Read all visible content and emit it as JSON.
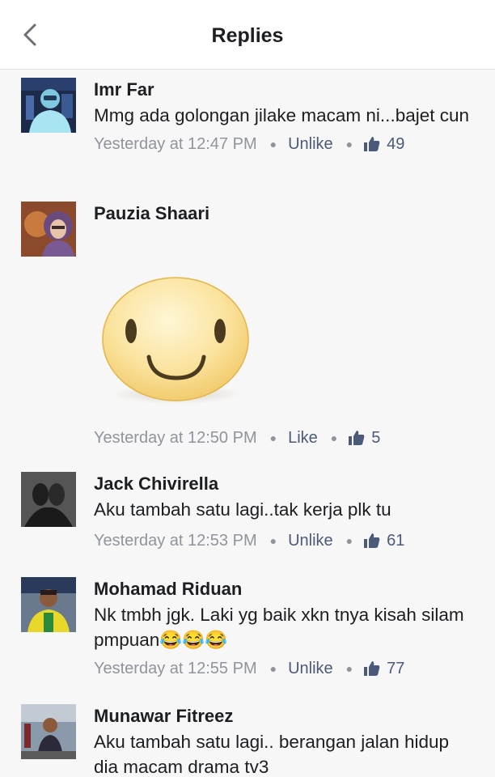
{
  "header": {
    "title": "Replies",
    "back_icon": "chevron-left-icon"
  },
  "colors": {
    "name": "#1c1e21",
    "meta": "#90949c",
    "action": "#4b5a78",
    "sticker": "#f7dc8a"
  },
  "comments": [
    {
      "name": "Imr Far",
      "text": "Mmg ada golongan jilake macam ni...bajet cun",
      "time": "Yesterday at 12:47 PM",
      "action": "Unlike",
      "likes": "49"
    },
    {
      "name": "Pauzia Shaari",
      "text": "",
      "time": "Yesterday at 12:50 PM",
      "action": "Like",
      "likes": "5",
      "sticker": "smiley-face-sticker"
    },
    {
      "name": "Jack Chivirella",
      "text": "Aku tambah satu lagi..tak kerja plk tu",
      "time": "Yesterday at 12:53 PM",
      "action": "Unlike",
      "likes": "61"
    },
    {
      "name": "Mohamad Riduan",
      "text": "Nk tmbh jgk. Laki yg baik xkn tnya kisah silam pmpuan😂😂😂",
      "time": "Yesterday at 12:55 PM",
      "action": "Unlike",
      "likes": "77"
    },
    {
      "name": "Munawar Fitreez",
      "text": "Aku tambah satu lagi.. berangan jalan hidup dia macam drama tv3",
      "time": "",
      "action": "",
      "likes": ""
    }
  ]
}
